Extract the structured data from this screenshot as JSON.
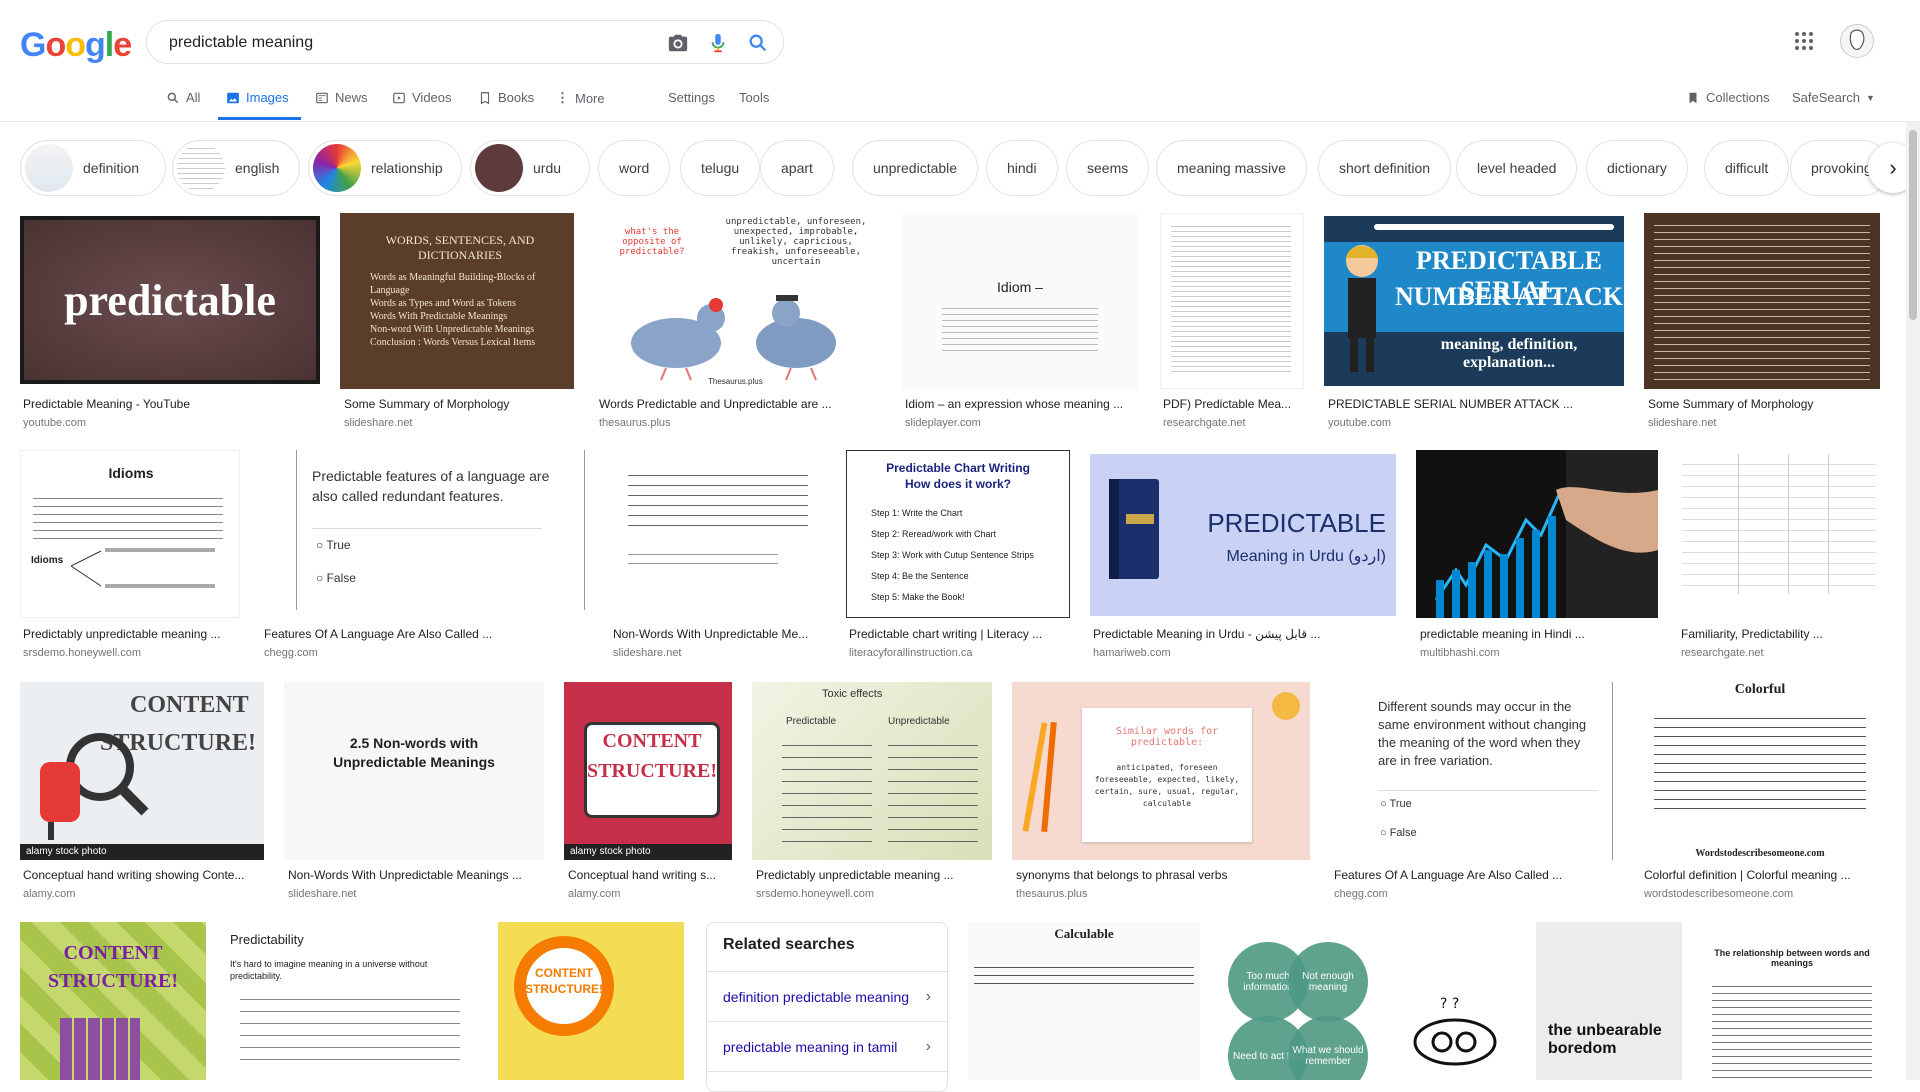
{
  "header": {
    "logo": "Google",
    "search_value": "predictable meaning",
    "camera_icon": "camera-icon",
    "mic_icon": "mic-icon",
    "search_icon": "search-icon"
  },
  "tabs": [
    {
      "label": "All"
    },
    {
      "label": "Images"
    },
    {
      "label": "News"
    },
    {
      "label": "Videos"
    },
    {
      "label": "Books"
    },
    {
      "label": "More"
    },
    {
      "label": "Settings"
    },
    {
      "label": "Tools"
    }
  ],
  "right_tools": {
    "collections": "Collections",
    "safesearch": "SafeSearch"
  },
  "chips": [
    {
      "label": "definition"
    },
    {
      "label": "english"
    },
    {
      "label": "relationship"
    },
    {
      "label": "urdu"
    },
    {
      "label": "word"
    },
    {
      "label": "telugu"
    },
    {
      "label": "apart"
    },
    {
      "label": "unpredictable"
    },
    {
      "label": "hindi"
    },
    {
      "label": "seems"
    },
    {
      "label": "meaning massive"
    },
    {
      "label": "short definition"
    },
    {
      "label": "level headed"
    },
    {
      "label": "dictionary"
    },
    {
      "label": "difficult"
    },
    {
      "label": "provoking"
    }
  ],
  "results": {
    "r0": {
      "caption": "Predictable Meaning - YouTube",
      "source": "youtube.com",
      "text": "predictable"
    },
    "r1": {
      "caption": "Some Summary of Morphology",
      "source": "slideshare.net",
      "title": "WORDS, SENTENCES, AND DICTIONARIES",
      "bullets": [
        "Words as Meaningful Building-Blocks of Language",
        "Words as Types and Word as Tokens",
        "Words With Predictable Meanings",
        "Non-word With Unpredictable Meanings",
        "Conclusion : Words Versus Lexical Items"
      ]
    },
    "r2": {
      "caption": "Words Predictable and Unpredictable are ...",
      "source": "thesaurus.plus",
      "question": "what's the opposite of predictable?",
      "words": "unpredictable, unforeseen, unexpected, improbable, unlikely, capricious, freakish, unforeseeable, uncertain",
      "brand": "Thesaurus.plus"
    },
    "r3": {
      "caption": "Idiom – an expression whose meaning ...",
      "source": "slideplayer.com",
      "title": "Idiom –"
    },
    "r4": {
      "caption": "PDF) Predictable Mea...",
      "source": "researchgate.net"
    },
    "r5": {
      "caption": "PREDICTABLE SERIAL NUMBER ATTACK ...",
      "source": "youtube.com",
      "line1": "PREDICTABLE SERIAL",
      "line2": "NUMBER ATTACK",
      "line3": "meaning, definition, explanation..."
    },
    "r6": {
      "caption": "Some Summary of Morphology",
      "source": "slideshare.net"
    },
    "r7": {
      "caption": "Predictably unpredictable meaning ...",
      "source": "srsdemo.honeywell.com",
      "title": "Idioms",
      "label": "Idioms"
    },
    "r8": {
      "caption": "Features Of A Language Are Also Called ...",
      "source": "chegg.com",
      "question": "Predictable features of a language are also called redundant features.",
      "opt1": "True",
      "opt2": "False"
    },
    "r9": {
      "caption": "Non-Words With Unpredictable Me...",
      "source": "slideshare.net"
    },
    "r10": {
      "caption": "Predictable chart writing | Literacy ...",
      "source": "literacyforallinstruction.ca",
      "title": "Predictable Chart Writing",
      "subtitle": "How does it work?",
      "steps": [
        "Step 1: Write the Chart",
        "Step 2: Reread/work with Chart",
        "Step 3: Work with Cutup Sentence Strips",
        "Step 4: Be the Sentence",
        "Step 5: Make the Book!"
      ]
    },
    "r11": {
      "caption": "Predictable Meaning in Urdu - قابل پیشن ...",
      "source": "hamariweb.com",
      "title": "PREDICTABLE",
      "subtitle": "Meaning in Urdu (اردو)"
    },
    "r12": {
      "caption": "predictable meaning in Hindi ...",
      "source": "multibhashi.com"
    },
    "r13": {
      "caption": "Familiarity, Predictability ...",
      "source": "researchgate.net"
    },
    "r14": {
      "caption": "Conceptual hand writing showing Conte...",
      "source": "alamy.com",
      "text1": "CONTENT",
      "text2": "STRUCTURE!",
      "watermark": "alamy stock photo"
    },
    "r15": {
      "caption": "Non-Words With Unpredictable Meanings ...",
      "source": "slideshare.net",
      "title": "2.5 Non-words with Unpredictable Meanings"
    },
    "r16": {
      "caption": "Conceptual hand writing s...",
      "source": "alamy.com",
      "text1": "CONTENT",
      "text2": "STRUCTURE!",
      "watermark": "alamy stock photo"
    },
    "r17": {
      "caption": "Predictably unpredictable meaning ...",
      "source": "srsdemo.honeywell.com",
      "title": "Toxic effects",
      "left": "Predictable",
      "right": "Unpredictable"
    },
    "r18": {
      "caption": "synonyms that belongs to phrasal verbs",
      "source": "thesaurus.plus",
      "title": "Similar words for predictable:",
      "words": "anticipated, foreseen foreseeable, expected, likely, certain, sure, usual, regular, calculable"
    },
    "r19": {
      "caption": "Features Of A Language Are Also Called ...",
      "source": "chegg.com",
      "question": "Different sounds may occur in the same environment without changing the meaning of the word when they are in free variation.",
      "opt1": "True",
      "opt2": "False"
    },
    "r20": {
      "caption": "Colorful definition | Colorful meaning ...",
      "source": "wordstodescribesomeone.com",
      "title": "Colorful",
      "footer": "Wordstodescribesomeone.com"
    },
    "r21": {
      "text1": "CONTENT",
      "text2": "STRUCTURE!"
    },
    "r22": {
      "title": "Predictability",
      "bullet": "It's hard to imagine meaning in a universe without predictability."
    },
    "r23": {
      "text1": "CONTENT",
      "text2": "STRUCTURE!"
    },
    "r24": {
      "title": "Calculable"
    },
    "r25": {
      "c1": "Too much information",
      "c2": "Not enough meaning",
      "c3": "Need to act fast",
      "c4": "What we should remember"
    },
    "r26": {},
    "r27": {
      "text": "the unbearable boredom"
    },
    "r28": {
      "title": "The relationship between words and meanings"
    }
  },
  "related": {
    "title": "Related searches",
    "items": [
      {
        "label": "definition predictable meaning"
      },
      {
        "label": "predictable meaning in tamil"
      }
    ]
  },
  "colors": {
    "accent": "#1a73e8",
    "link": "#1a0dab"
  }
}
